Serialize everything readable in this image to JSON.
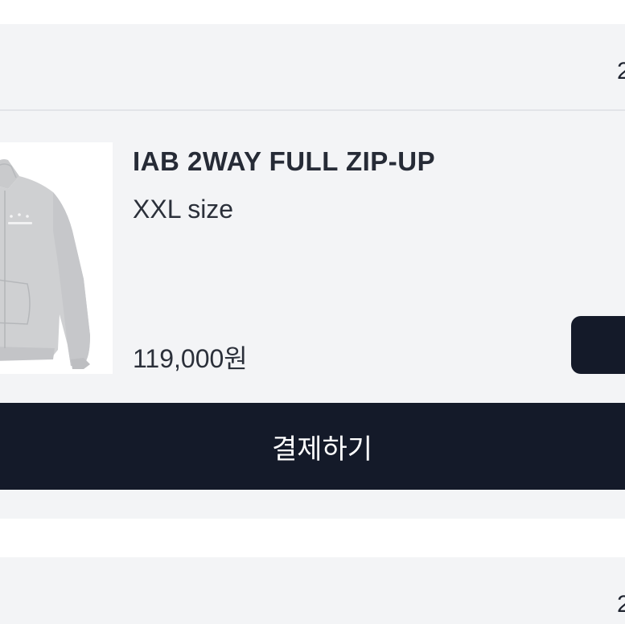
{
  "order_card": {
    "header_text": "2"
  },
  "product": {
    "name": "IAB 2WAY FULL ZIP-UP",
    "option": "XXL size",
    "price": "119,000원",
    "image_icon": "gray-zip-up-hoodie-image"
  },
  "actions": {
    "checkout_label": "결제하기"
  },
  "next_card": {
    "header_text": "2"
  },
  "colors": {
    "background": "#ffffff",
    "card": "#f3f4f6",
    "button": "#141a29",
    "divider": "#e2e4e8"
  }
}
